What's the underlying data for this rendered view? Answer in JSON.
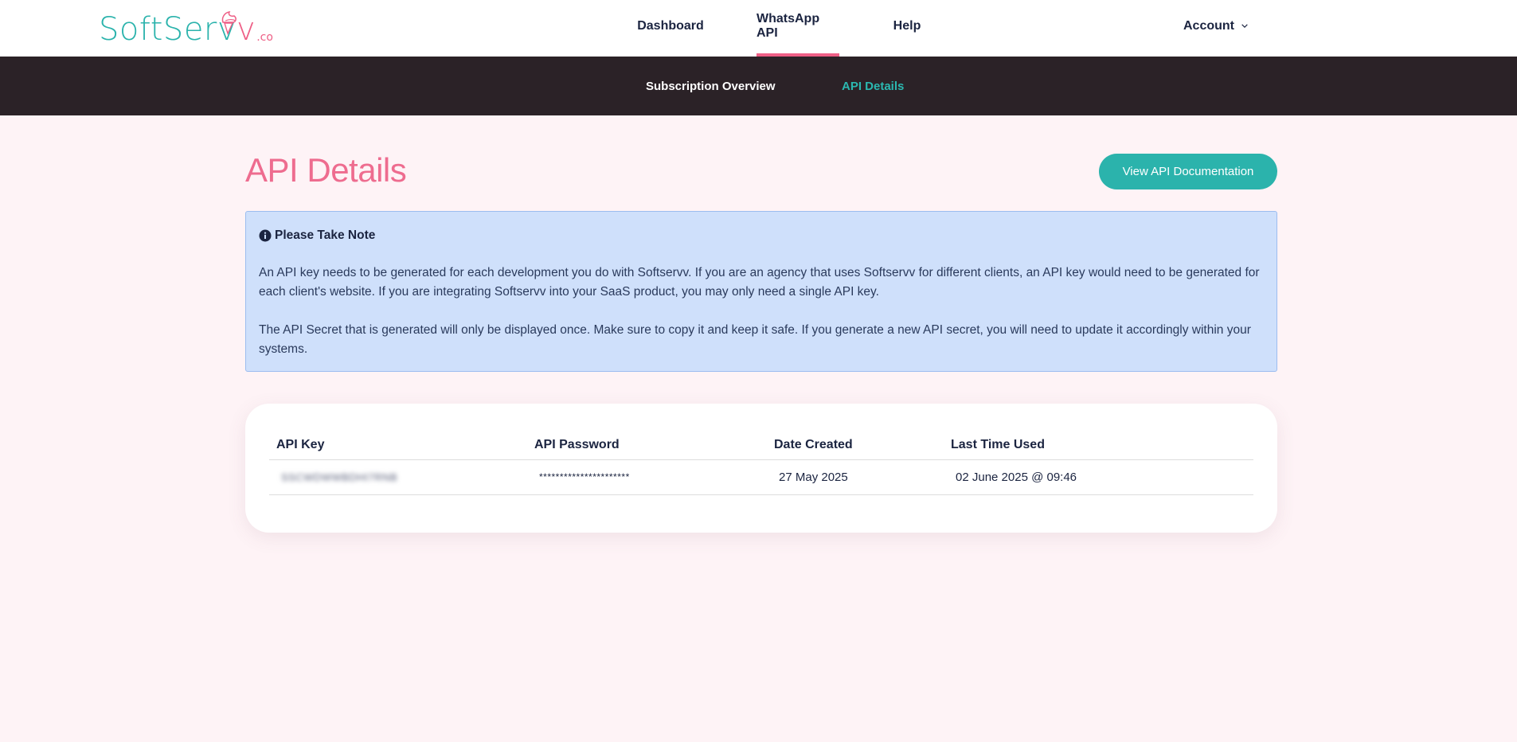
{
  "brand": {
    "name_main": "SoftServ",
    "name_v": "v",
    "suffix": ".co",
    "primary_color": "#2bb3ac",
    "accent_color": "#ee5f86"
  },
  "header": {
    "nav": [
      {
        "label": "Dashboard",
        "active": false
      },
      {
        "label": "WhatsApp API",
        "active": true
      },
      {
        "label": "Help",
        "active": false
      }
    ],
    "account_label": "Account"
  },
  "subnav": {
    "items": [
      {
        "label": "Subscription Overview",
        "active": false
      },
      {
        "label": "API Details",
        "active": true
      }
    ]
  },
  "page": {
    "title": "API Details",
    "doc_button": "View API Documentation"
  },
  "note": {
    "heading": "Please Take Note",
    "paragraphs": [
      "An API key needs to be generated for each development you do with Softservv. If you are an agency that uses Softservv for different clients, an API key would need to be generated for each client's website. If you are integrating Softservv into your SaaS product, you may only need a single API key.",
      "The API Secret that is generated will only be displayed once. Make sure to copy it and keep it safe. If you generate a new API secret, you will need to update it accordingly within your systems."
    ]
  },
  "table": {
    "headers": [
      "API Key",
      "API Password",
      "Date Created",
      "Last Time Used"
    ],
    "rows": [
      {
        "api_key": "SSCWDWWBDHI7RNB",
        "api_password": "**********************",
        "date_created": "27 May 2025",
        "last_used": "02 June 2025 @ 09:46"
      }
    ]
  }
}
